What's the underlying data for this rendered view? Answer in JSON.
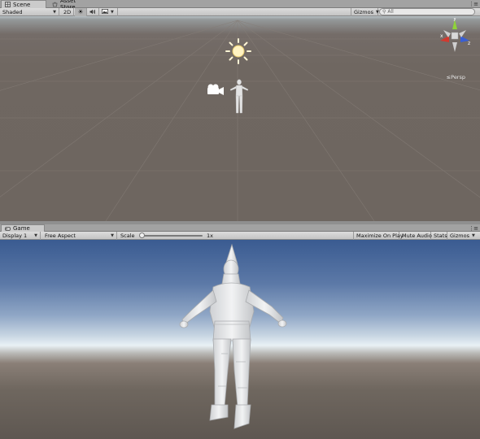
{
  "scene_tabs": [
    {
      "label": "Scene",
      "icon": "scene-icon",
      "active": true
    },
    {
      "label": "Asset Store",
      "icon": "store-icon",
      "active": false
    }
  ],
  "scene_toolbar": {
    "shading": "Shaded",
    "mode_2d": "2D",
    "gizmos": "Gizmos",
    "search_placeholder": "All"
  },
  "scene_view": {
    "projection": "Persp",
    "gizmo_axes": {
      "y": "y",
      "x": "x",
      "z": "z"
    }
  },
  "game_tab": {
    "label": "Game",
    "icon": "game-icon"
  },
  "game_toolbar": {
    "display": "Display 1",
    "aspect": "Free Aspect",
    "scale_label": "Scale",
    "scale_value": "1x",
    "scale_fraction": 0.0,
    "maximize": "Maximize On Play",
    "mute": "Mute Audio",
    "stats": "Stats",
    "gizmos": "Gizmos"
  },
  "colors": {
    "axis_x": "#d13a2f",
    "axis_y": "#8fd33a",
    "axis_z": "#3a5fd3",
    "ground": "#6f6761",
    "sky_top": "#3a5b91"
  }
}
